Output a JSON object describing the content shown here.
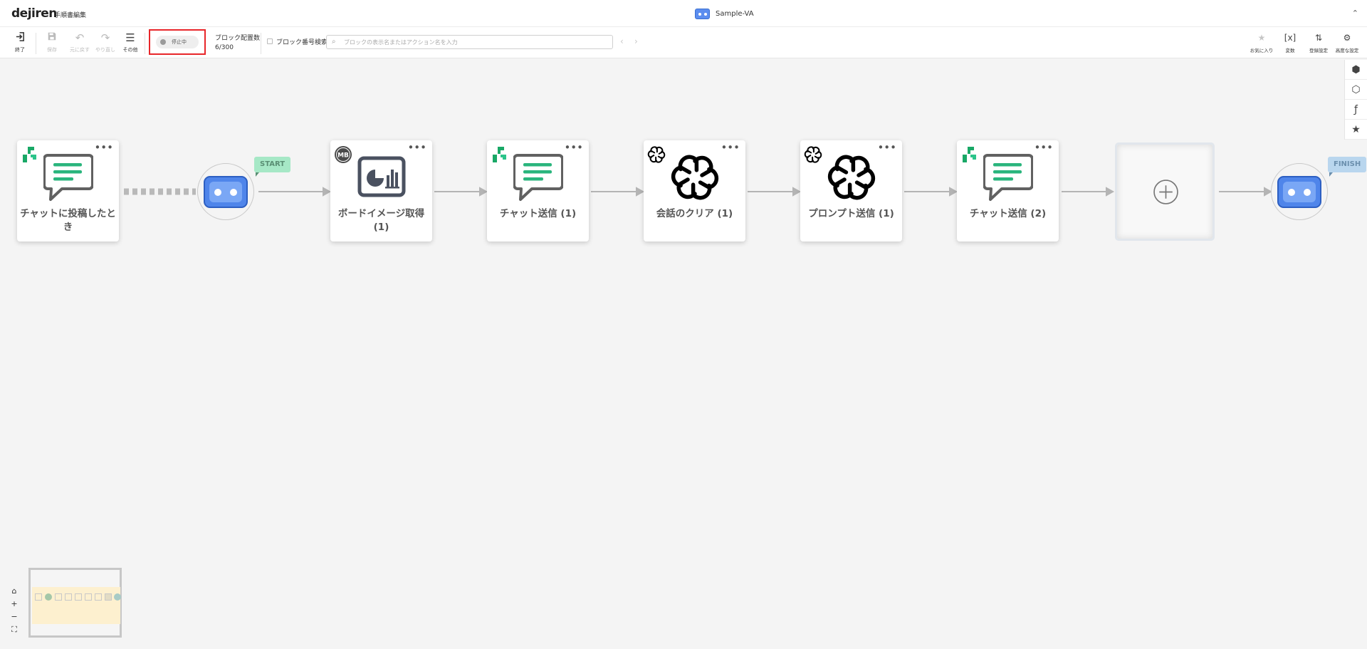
{
  "header": {
    "logo": "dejiren",
    "subtitle": "手順書編集",
    "app_title": "Sample-VA",
    "collapse_icon": "chevron-up-double-icon"
  },
  "toolbar": {
    "exit_label": "終了",
    "save_label": "保存",
    "undo_label": "元に戻す",
    "redo_label": "やり直し",
    "other_label": "その他",
    "status_label": "停止中",
    "block_count_label": "ブロック配置数",
    "block_count": "6/300",
    "block_number_search_label": "ブロック番号検索",
    "search_placeholder": "ブロックの表示名またはアクション名を入力",
    "favorites_label": "お気に入り",
    "variables_label": "変数",
    "variables_icon_text": "[x]",
    "general_settings_label": "登録設定",
    "advanced_settings_label": "高度な設定"
  },
  "flow": {
    "start_flag": "START",
    "finish_flag": "FINISH",
    "nodes": [
      {
        "label": "チャットに投稿したとき",
        "icon": "chat-bubble-icon",
        "badge": "dejiren-logo-icon"
      },
      {
        "label": "ボードイメージ取得 (1)",
        "icon": "board-chart-icon",
        "badge": "metabase-logo-icon"
      },
      {
        "label": "チャット送信 (1)",
        "icon": "chat-bubble-icon",
        "badge": "dejiren-logo-icon"
      },
      {
        "label": "会話のクリア (1)",
        "icon": "openai-logo-icon",
        "badge": "openai-logo-icon"
      },
      {
        "label": "プロンプト送信 (1)",
        "icon": "openai-logo-icon",
        "badge": "openai-logo-icon"
      },
      {
        "label": "チャット送信 (2)",
        "icon": "chat-bubble-icon",
        "badge": "dejiren-logo-icon"
      }
    ],
    "badge_mb_text": "MB"
  },
  "colors": {
    "accent_green": "#2ab57d",
    "robot_blue": "#4f85ea",
    "status_highlight": "#e8262a",
    "start_flag": "#a6e8c6",
    "finish_flag": "#b9d6ee"
  }
}
